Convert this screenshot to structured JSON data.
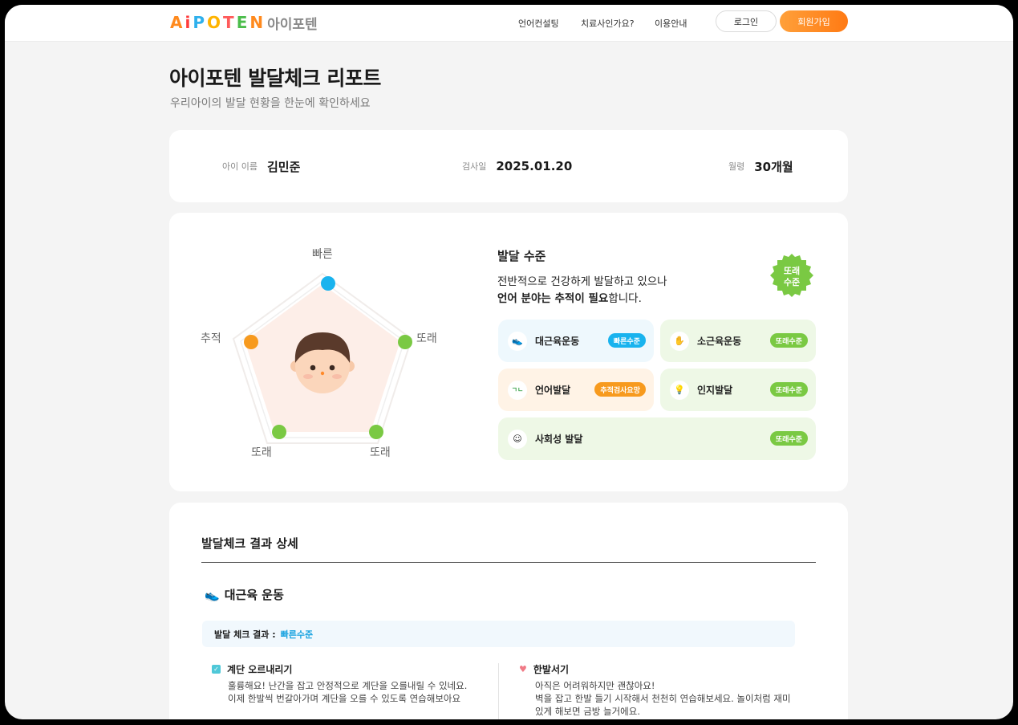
{
  "header": {
    "logo_letters": [
      {
        "ch": "A",
        "color": "#ff8a1e"
      },
      {
        "ch": "i",
        "color": "#ff3b3b"
      },
      {
        "ch": "P",
        "color": "#2fb0ec"
      },
      {
        "ch": "O",
        "color": "#ffb400"
      },
      {
        "ch": "T",
        "color": "#ff5b5b"
      },
      {
        "ch": "E",
        "color": "#4bbd4b"
      },
      {
        "ch": "N",
        "color": "#ff8a1e"
      }
    ],
    "logo_korean": "아이포텐",
    "nav": [
      "언어컨설팅",
      "치료사인가요?",
      "이용안내"
    ],
    "login": "로그인",
    "signup": "회원가입"
  },
  "page": {
    "title": "아이포텐 발달체크 리포트",
    "subtitle": "우리아이의 발달 현황을 한눈에 확인하세요"
  },
  "info": {
    "name_label": "아이 이름",
    "name_value": "김민준",
    "date_label": "검사일",
    "date_value": "2025.01.20",
    "age_label": "월령",
    "age_value": "30개월"
  },
  "radar": {
    "labels": [
      "빠른",
      "또래",
      "또래",
      "또래",
      "추적"
    ],
    "point_colors": [
      "#19b3ee",
      "#7ac943",
      "#7ac943",
      "#7ac943",
      "#f79a1e"
    ]
  },
  "level": {
    "title": "발달 수준",
    "desc_line1": "전반적으로 건강하게 발달하고 있으나",
    "desc_line2_bold": "언어 분야는 추적이 필요",
    "desc_line2_rest": "합니다.",
    "seal_line1": "또래",
    "seal_line2": "수준",
    "seal_color": "#7ac943"
  },
  "tiles": [
    {
      "name": "대근육운동",
      "badge": "빠른수준",
      "icon": "sneaker-icon",
      "glyph": "👟",
      "bg": "#eef8fd",
      "badge_color": "#19b3ee"
    },
    {
      "name": "소근육운동",
      "badge": "또래수준",
      "icon": "hand-icon",
      "glyph": "✋",
      "bg": "#eef8e6",
      "badge_color": "#7ac943"
    },
    {
      "name": "언어발달",
      "badge": "추적검사요망",
      "icon": "speech-icon",
      "glyph": "ㄱㄴ",
      "bg": "#fff3e6",
      "badge_color": "#f79a1e"
    },
    {
      "name": "인지발달",
      "badge": "또래수준",
      "icon": "bulb-icon",
      "glyph": "💡",
      "bg": "#eef8e6",
      "badge_color": "#7ac943"
    },
    {
      "name": "사회성 발달",
      "badge": "또래수준",
      "icon": "smile-icon",
      "glyph": "☺",
      "bg": "#eef8e6",
      "badge_color": "#7ac943"
    }
  ],
  "detail": {
    "section_title": "발달체크 결과 상세",
    "category_title": "대근육 운동",
    "result_label": "발달 체크 결과 :",
    "result_value": "빠른수준",
    "items": [
      {
        "title": "계단 오르내리기",
        "line1": "훌륭해요! 난간을 잡고 안정적으로 계단을 오를내릴 수 있네요.",
        "line2": "이제 한발씩 번갈아가며 계단을 오를 수 있도록 연습해보아요"
      },
      {
        "title": "한발서기",
        "line1": "아직은 어려워하지만 괜찮아요!",
        "line2": "벽을 잡고 한발 들기 시작해서 천천히 연습해보세요. 놀이처럼 재미",
        "line3": "있게 해보면 금방 늘거에요."
      }
    ]
  }
}
